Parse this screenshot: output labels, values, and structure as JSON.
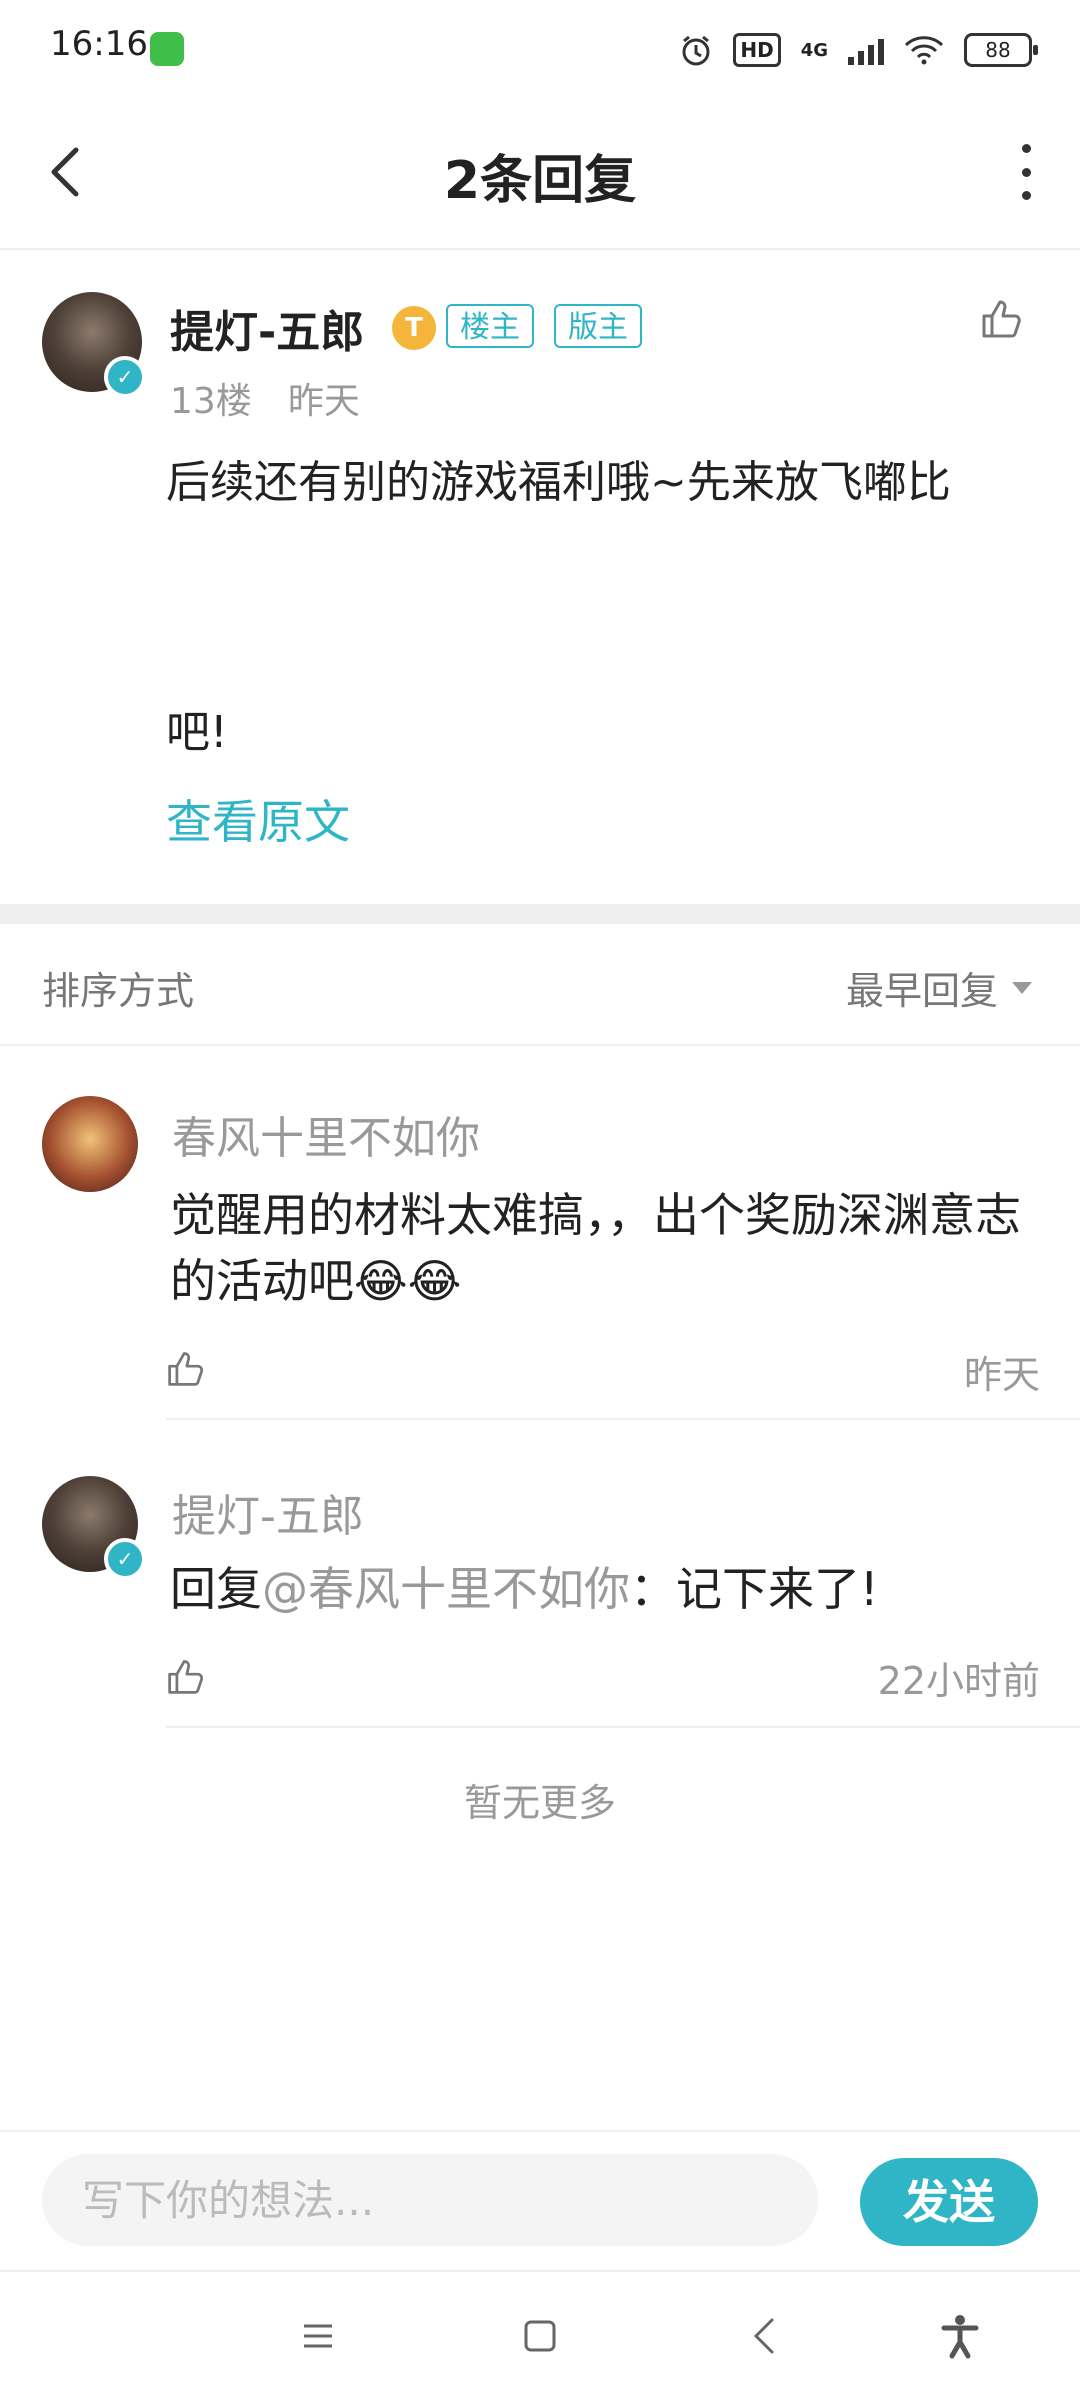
{
  "status_bar": {
    "time": "16:16",
    "network": "4G",
    "hd": "HD",
    "battery": "88"
  },
  "header": {
    "title": "2条回复"
  },
  "post": {
    "author": "提灯-五郎",
    "level_badge": "T",
    "tags": [
      "楼主",
      "版主"
    ],
    "floor": "13楼",
    "time": "昨天",
    "text_line1": "后续还有别的游戏福利哦~先来放飞嘟比",
    "text_line2": "吧!",
    "view_original": "查看原文"
  },
  "sort": {
    "label": "排序方式",
    "value": "最早回复"
  },
  "replies": [
    {
      "author": "春风十里不如你",
      "text": "觉醒用的材料太难搞，，出个奖励深渊意志的活动吧😂😂",
      "time": "昨天"
    },
    {
      "author": "提灯-五郎",
      "text_prefix": "回复",
      "mention": "@春风十里不如你",
      "text_suffix": "：记下来了!",
      "time": "22小时前"
    }
  ],
  "no_more": "暂无更多",
  "input": {
    "placeholder": "写下你的想法...",
    "send": "发送"
  },
  "colors": {
    "accent": "#2fb5c5",
    "muted": "#999999",
    "text": "#222222",
    "badge_gold": "#f4b53a"
  },
  "icons": [
    "back-icon",
    "more-icon",
    "thumbs-up-icon",
    "verified-icon",
    "menu-icon",
    "home-icon",
    "nav-back-icon",
    "accessibility-icon"
  ]
}
